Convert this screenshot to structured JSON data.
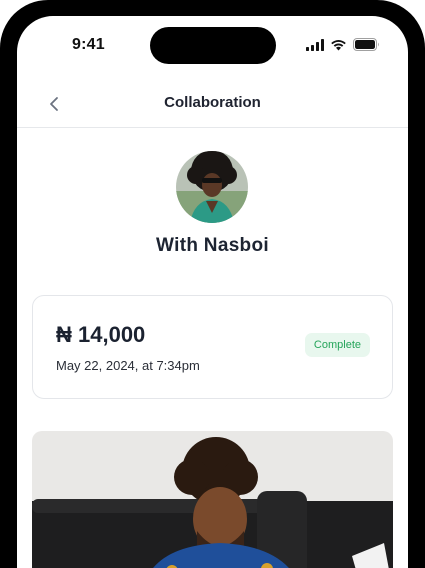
{
  "status_bar": {
    "time": "9:41",
    "icons": [
      "signal-icon",
      "wifi-icon",
      "battery-icon"
    ]
  },
  "nav": {
    "back_icon": "chevron-left-icon",
    "title": "Collaboration"
  },
  "profile": {
    "with_label": "With Nasboi"
  },
  "transaction": {
    "amount": "₦ 14,000",
    "date": "May 22, 2024, at 7:34pm",
    "status": "Complete"
  },
  "colors": {
    "status_green": "#25a45a",
    "status_green_bg": "#e8f7ee",
    "title_text": "#1d2432"
  }
}
